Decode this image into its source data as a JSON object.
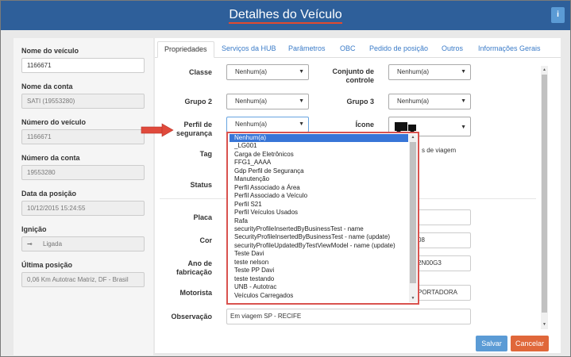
{
  "window": {
    "title": "Detalhes do Veículo",
    "info_label": "i"
  },
  "left": {
    "vehicle_name_label": "Nome do veículo",
    "vehicle_name_value": "1166671",
    "account_name_label": "Nome da conta",
    "account_name_value": "SATI (19553280)",
    "vehicle_number_label": "Número do veículo",
    "vehicle_number_value": "1166671",
    "account_number_label": "Número da conta",
    "account_number_value": "19553280",
    "position_date_label": "Data da posição",
    "position_date_value": "10/12/2015 15:24:55",
    "ignition_label": "Ignição",
    "ignition_value": "Ligada",
    "last_position_label": "Última posição",
    "last_position_value": "0,06 Km Autotrac Matriz, DF - Brasil"
  },
  "tabs": [
    "Propriedades",
    "Serviços da HUB",
    "Parâmetros",
    "OBC",
    "Pedido de posição",
    "Outros",
    "Informações Gerais"
  ],
  "form": {
    "classe_label": "Classe",
    "classe_value": "Nenhum(a)",
    "conjunto_label_1": "Conjunto de",
    "conjunto_label_2": "controle",
    "conjunto_value": "Nenhum(a)",
    "grupo2_label": "Grupo 2",
    "grupo2_value": "Nenhum(a)",
    "grupo3_label": "Grupo 3",
    "grupo3_value": "Nenhum(a)",
    "perfil_label_1": "Perfil de",
    "perfil_label_2": "segurança",
    "perfil_value": "Nenhum(a)",
    "icone_label": "Ícone",
    "tag_label": "Tag",
    "viagem_text": "s de viagem",
    "status_label": "Status",
    "placa_label": "Placa",
    "cor_label": "Cor",
    "cor_value_partial": "08",
    "ano_label_1": "Ano de",
    "ano_label_2": "fabricação",
    "ano_value_partial": "2N00G3",
    "motorista_label": "Motorista",
    "motorista_value_partial": "PORTADORA",
    "observacao_label": "Observação",
    "observacao_value": "Em viagem SP - RECIFE"
  },
  "dropdown": {
    "items": [
      "Nenhum(a)",
      "_LG001",
      "Carga de Eletrônicos",
      "FFG1_AAAA",
      "Gdp Perfil de Segurança",
      "Manutenção",
      "Perfil Associado a Área",
      "Perfil Associado a Veículo",
      "Perfil S21",
      "Perfil Veículos Usados",
      "Rafa",
      "securityProfileInsertedByBusinessTest - name",
      "SecurityProfileInsertedByBusinessTest - name (update)",
      "securityProfileUpdatedByTestViewModel - name (update)",
      "Teste Davi",
      "teste nelson",
      "Teste PP Davi",
      "teste testando",
      "UNB - Autotrac",
      "Veículos Carregados"
    ],
    "selected_index": 0
  },
  "buttons": {
    "save": "Salvar",
    "cancel": "Cancelar"
  },
  "colors": {
    "titlebar": "#2e5f9a",
    "save": "#5b9bd5",
    "cancel": "#e0673a",
    "highlight": "#d9534f"
  }
}
